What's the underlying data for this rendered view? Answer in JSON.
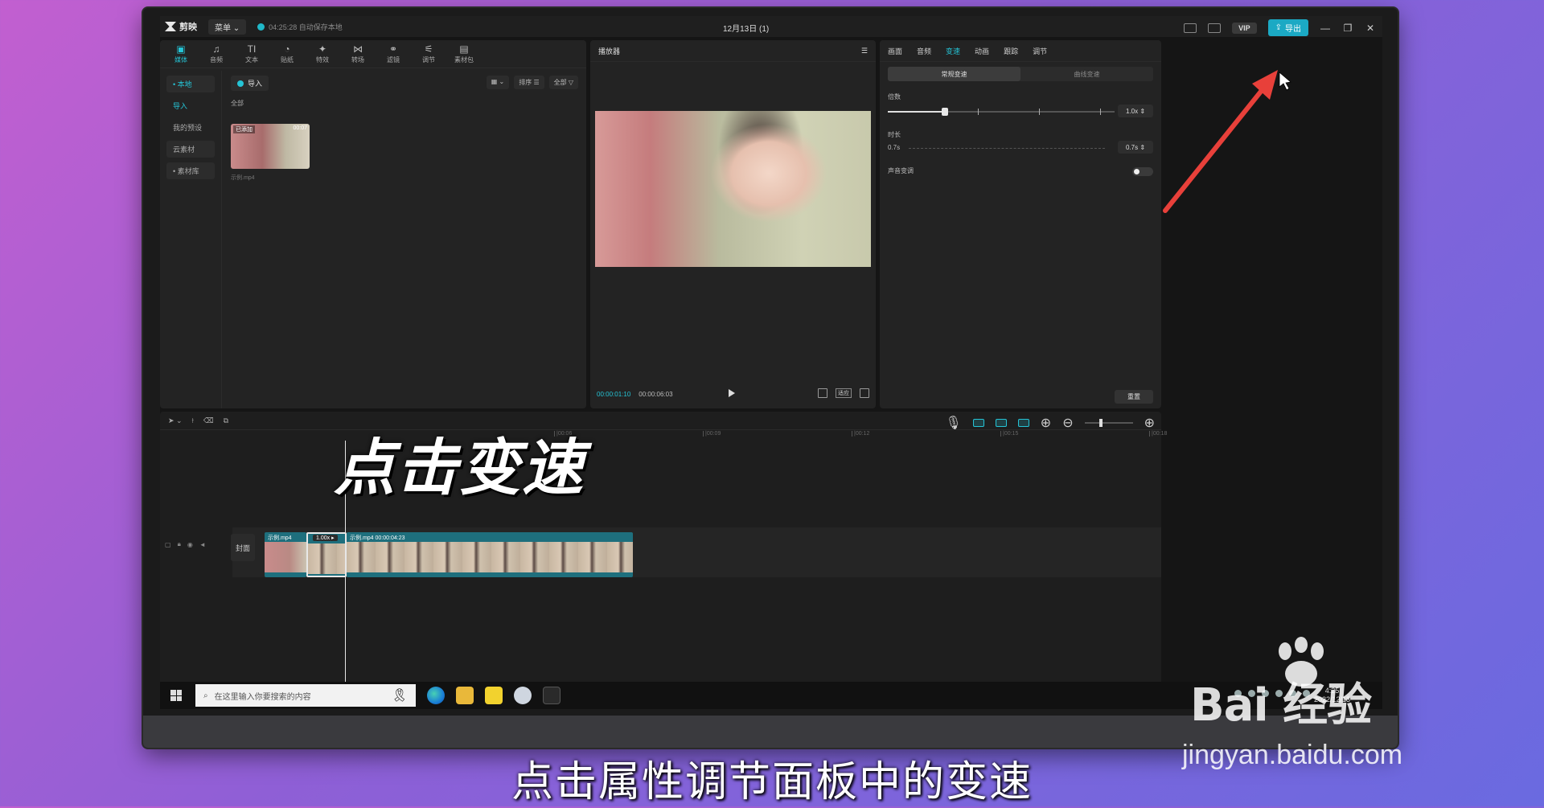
{
  "titlebar": {
    "app_name": "剪映",
    "menu": "菜单",
    "autosave": "04:25:28 自动保存本地",
    "doc_title": "12月13日 (1)",
    "vip": "VIP",
    "export": "导出"
  },
  "toolbar": [
    "媒体",
    "音频",
    "文本",
    "贴纸",
    "特效",
    "转场",
    "滤镜",
    "调节",
    "素材包"
  ],
  "toolbar_icons": [
    "▣",
    "♫",
    "TI",
    "◔",
    "✦",
    "⋈",
    "⚭",
    "⚟",
    "▤"
  ],
  "side_nav": [
    "• 本地",
    "导入",
    "我的预设",
    "云素材",
    "• 素材库"
  ],
  "media": {
    "import": "导入",
    "layout_btn": "▦ ⌄",
    "sort": "排序 ☰",
    "filter": "全部 ▽",
    "all": "全部",
    "thumb_tag": "已添加",
    "thumb_dur": "00:07",
    "thumb_name": "示例.mp4"
  },
  "player": {
    "title": "播放器",
    "time_current": "00:00:01:10",
    "time_total": "00:00:06:03",
    "ratio": "适应"
  },
  "properties": {
    "tabs": [
      "画面",
      "音频",
      "变速",
      "动画",
      "跟踪",
      "调节"
    ],
    "active_tab": "变速",
    "segments": [
      "常规变速",
      "曲线变速"
    ],
    "speed_label": "倍数",
    "speed_value": "1.0x",
    "speed_fraction": 0.25,
    "duration_label": "时长",
    "duration_left": "0.7s",
    "duration_value": "0.7s",
    "pitch_label": "声音变调",
    "reset": "重置"
  },
  "timeline": {
    "ruler": [
      "|00:06",
      "|00:09",
      "|00:12",
      "|00:15",
      "|00:18"
    ],
    "cover": "封面",
    "clip1_label": "示例.mp4",
    "clip2_speed": "1.00x ▸",
    "clip3_label": "示例.mp4   00:00:04:23"
  },
  "overlay_caption": "点击变速",
  "taskbar": {
    "search_placeholder": "在这里输入你要搜索的内容",
    "time": "4:25",
    "date": "2022/12/13"
  },
  "bottom_caption": "点击属性调节面板中的变速",
  "watermark": {
    "brand": "Bai  经验",
    "url": "jingyan.baidu.com"
  },
  "colors": {
    "accent": "#25c4d6",
    "arrow": "#e8403a"
  }
}
